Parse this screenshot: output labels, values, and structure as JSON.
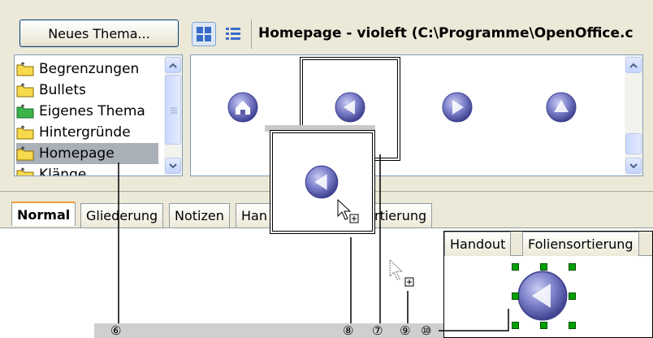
{
  "toolbar": {
    "new_theme_button": "Neues Thema...",
    "title": "Homepage - violeft (C:\\Programme\\OpenOffice.c"
  },
  "theme_list": {
    "items": [
      {
        "label": "Begrenzungen",
        "selected": false
      },
      {
        "label": "Bullets",
        "selected": false
      },
      {
        "label": "Eigenes Thema",
        "selected": false,
        "folder_color": "green"
      },
      {
        "label": "Hintergründe",
        "selected": false
      },
      {
        "label": "Homepage",
        "selected": true
      },
      {
        "label": "Klänge",
        "selected": false
      }
    ]
  },
  "gallery": {
    "icons": [
      "home-button-icon",
      "arrow-left-button-icon",
      "arrow-right-button-icon",
      "arrow-up-button-icon"
    ]
  },
  "view_tabs": {
    "tabs": [
      "Normal",
      "Gliederung",
      "Notizen",
      "Han",
      "rtierung"
    ]
  },
  "inset_tabs": {
    "tabs": [
      "Handout",
      "Foliensortierung"
    ]
  },
  "callouts": [
    "⑥",
    "⑧",
    "⑦",
    "⑨",
    "⑩"
  ],
  "colors": {
    "violet": "#7b7fc9",
    "folder_yellow": "#f7d94c",
    "folder_green": "#3bb44a",
    "selection": "#aab0b8",
    "handle_green": "#00a000"
  }
}
